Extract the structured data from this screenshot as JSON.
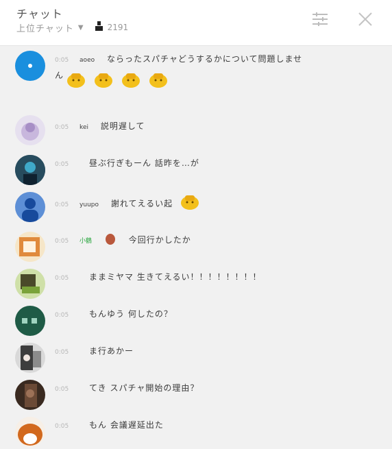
{
  "header": {
    "title": "チャット",
    "subtitle": "上位チャット",
    "caret": "▼",
    "viewers": "2191",
    "person_icon": "person-icon",
    "settings_icon": "settings-icon",
    "close_icon": "close-icon"
  },
  "colors": {
    "moderator": "#2ba640",
    "timestamp": "#b7b7b7",
    "background": "#f1f1f1"
  },
  "messages": [
    {
      "time": "0:05",
      "author": "aoeo",
      "text": "ならったスパチャどうするかについて問題しませ\nん",
      "emojis": 4
    },
    {
      "time": "0:05",
      "author": "kei",
      "text": "説明遅して"
    },
    {
      "time": "0:05",
      "author": "",
      "text": "昼ぶ行ぎもーん 話昨を…が"
    },
    {
      "time": "0:05",
      "author": "yuupo",
      "text": "謝れてえるい起",
      "emojis": 1
    },
    {
      "time": "0:05",
      "author": "小鶴",
      "text": "今回行かしたか"
    },
    {
      "time": "0:05",
      "author": "",
      "text": "ままミヤマ 生きてえるい！！！！！！！！"
    },
    {
      "time": "0:05",
      "author": "",
      "text": "もんゆう 何したの？"
    },
    {
      "time": "0:05",
      "author": "",
      "text": "ま行あかー"
    },
    {
      "time": "0:05",
      "author": "",
      "text": "てき スパチャ開始の理由？"
    },
    {
      "time": "0:05",
      "author": "",
      "text": "もん 会議遅延出た"
    }
  ]
}
